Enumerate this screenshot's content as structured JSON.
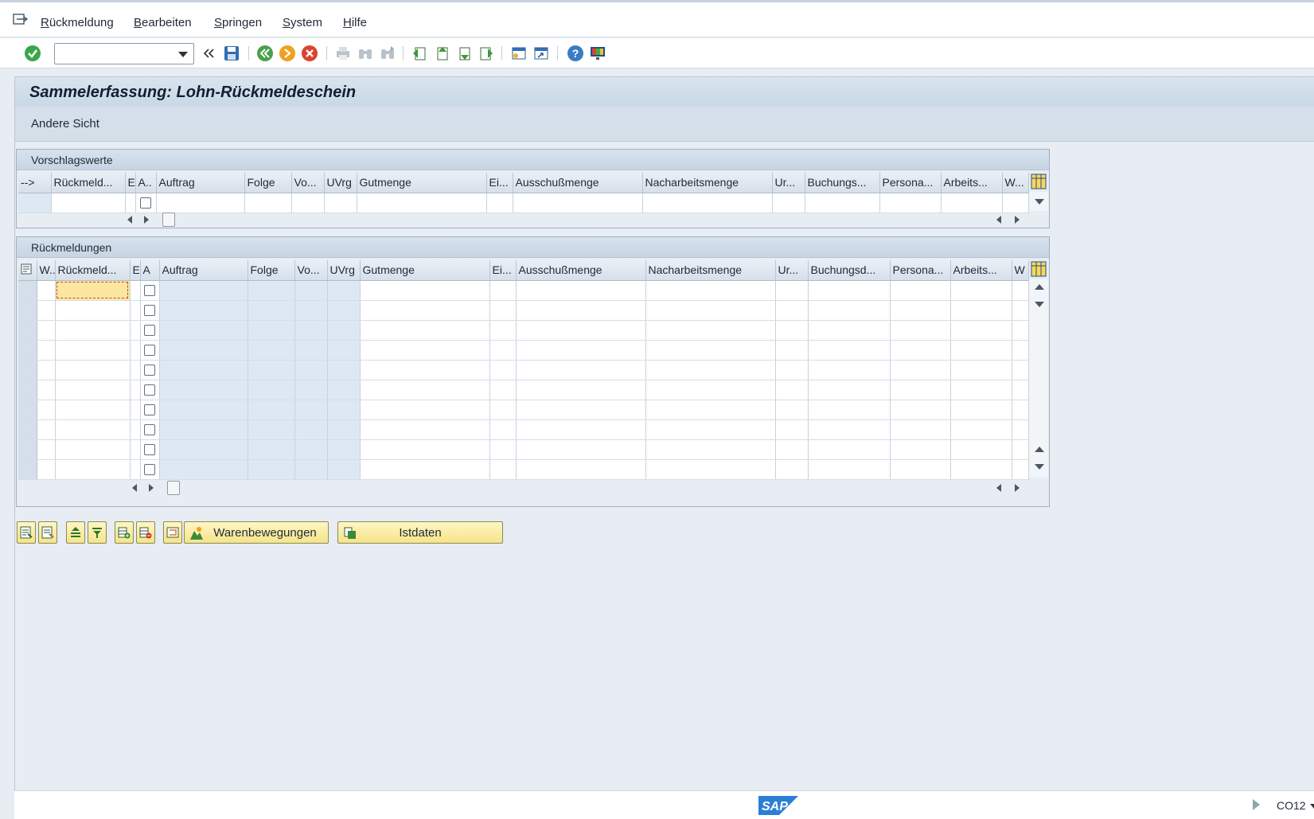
{
  "menubar": {
    "items": [
      "Rückmeldung",
      "Bearbeiten",
      "Springen",
      "System",
      "Hilfe"
    ]
  },
  "toolbar": {
    "command_field_value": ""
  },
  "title": "Sammelerfassung: Lohn-Rückmeldeschein",
  "appbar": {
    "andere_sicht": "Andere Sicht"
  },
  "vorschlag": {
    "header": "Vorschlagswerte",
    "columns": [
      "-->",
      "Rückmeld...",
      "E",
      "A..",
      "Auftrag",
      "Folge",
      "Vo...",
      "UVrg",
      "Gutmenge",
      "Ei...",
      "Ausschußmenge",
      "Nacharbeitsmenge",
      "Ur...",
      "Buchungs...",
      "Persona...",
      "Arbeits...",
      "W..."
    ]
  },
  "rueck": {
    "header": "Rückmeldungen",
    "columns": [
      "",
      "W..",
      "Rückmeld...",
      "E",
      "A",
      "Auftrag",
      "Folge",
      "Vo...",
      "UVrg",
      "Gutmenge",
      "Ei...",
      "Ausschußmenge",
      "Nacharbeitsmenge",
      "Ur...",
      "Buchungsd...",
      "Persona...",
      "Arbeits...",
      "W"
    ]
  },
  "buttons": {
    "warenbewegungen": "Warenbewegungen",
    "istdaten": "Istdaten"
  },
  "status": {
    "tcode": "CO12",
    "logo": "SAP"
  },
  "colors": {
    "title_bg": "#c9d8e6",
    "button_yellow": "#f6e488",
    "selected_cell": "#fbe7a1"
  }
}
